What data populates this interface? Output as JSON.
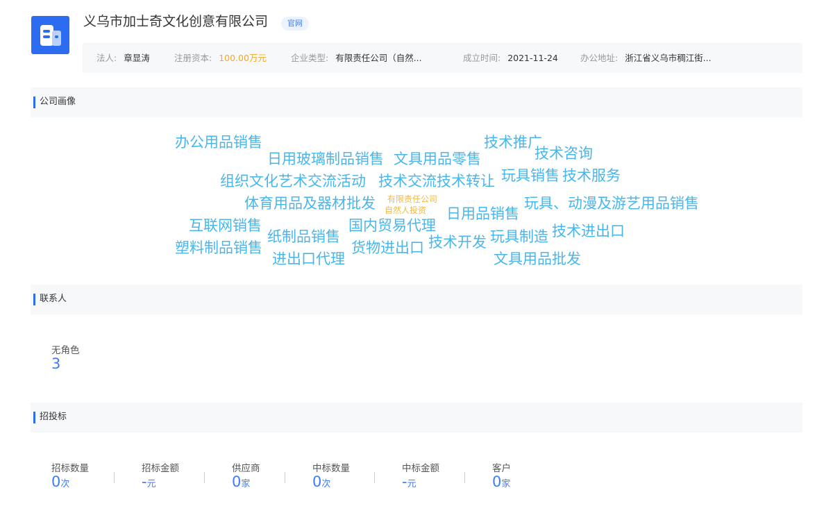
{
  "header": {
    "company_name": "义乌市加士奇文化创意有限公司",
    "official_tag": "官网",
    "logo_icon": "building-icon",
    "info": [
      {
        "label": "法人:",
        "value": "章显涛"
      },
      {
        "label": "注册资本:",
        "value": "100.00万元"
      },
      {
        "label": "企业类型:",
        "value": "有限责任公司（自然..."
      },
      {
        "label": "成立时间:",
        "value": "2021-11-24"
      },
      {
        "label": "办公地址:",
        "value": "浙江省义乌市稠江街..."
      }
    ]
  },
  "profile": {
    "title": "公司画像",
    "tags": [
      "办公用品销售",
      "日用玻璃制品销售",
      "文具用品零售",
      "技术推广",
      "技术咨询",
      "组织文化艺术交流活动",
      "技术交流技术转让",
      "玩具销售",
      "技术服务",
      "体育用品及器材批发",
      "有限责任公司",
      "自然人投资",
      "日用品销售",
      "玩具、动漫及游艺用品销售",
      "互联网销售",
      "纸制品销售",
      "国内贸易代理",
      "技术开发",
      "玩具制造",
      "技术进出口",
      "塑料制品销售",
      "进出口代理",
      "货物进出口",
      "文具用品批发"
    ]
  },
  "contacts": {
    "title": "联系人",
    "role_label": "无角色",
    "role_count": "3"
  },
  "bidding": {
    "title": "招投标",
    "stats": [
      {
        "label": "招标数量",
        "value": "0",
        "unit": "次"
      },
      {
        "label": "招标金额",
        "value": "-",
        "unit": "元"
      },
      {
        "label": "供应商",
        "value": "0",
        "unit": "家"
      },
      {
        "label": "中标数量",
        "value": "0",
        "unit": "次"
      },
      {
        "label": "中标金额",
        "value": "-",
        "unit": "元"
      },
      {
        "label": "客户",
        "value": "0",
        "unit": "家"
      }
    ]
  },
  "colors": {
    "accent": "#2b6cf0",
    "tag_blue": "#48b6ea",
    "tag_orange": "#f5b83d",
    "capital_orange": "#f5a623",
    "stat_blue": "#3f7cf5"
  }
}
